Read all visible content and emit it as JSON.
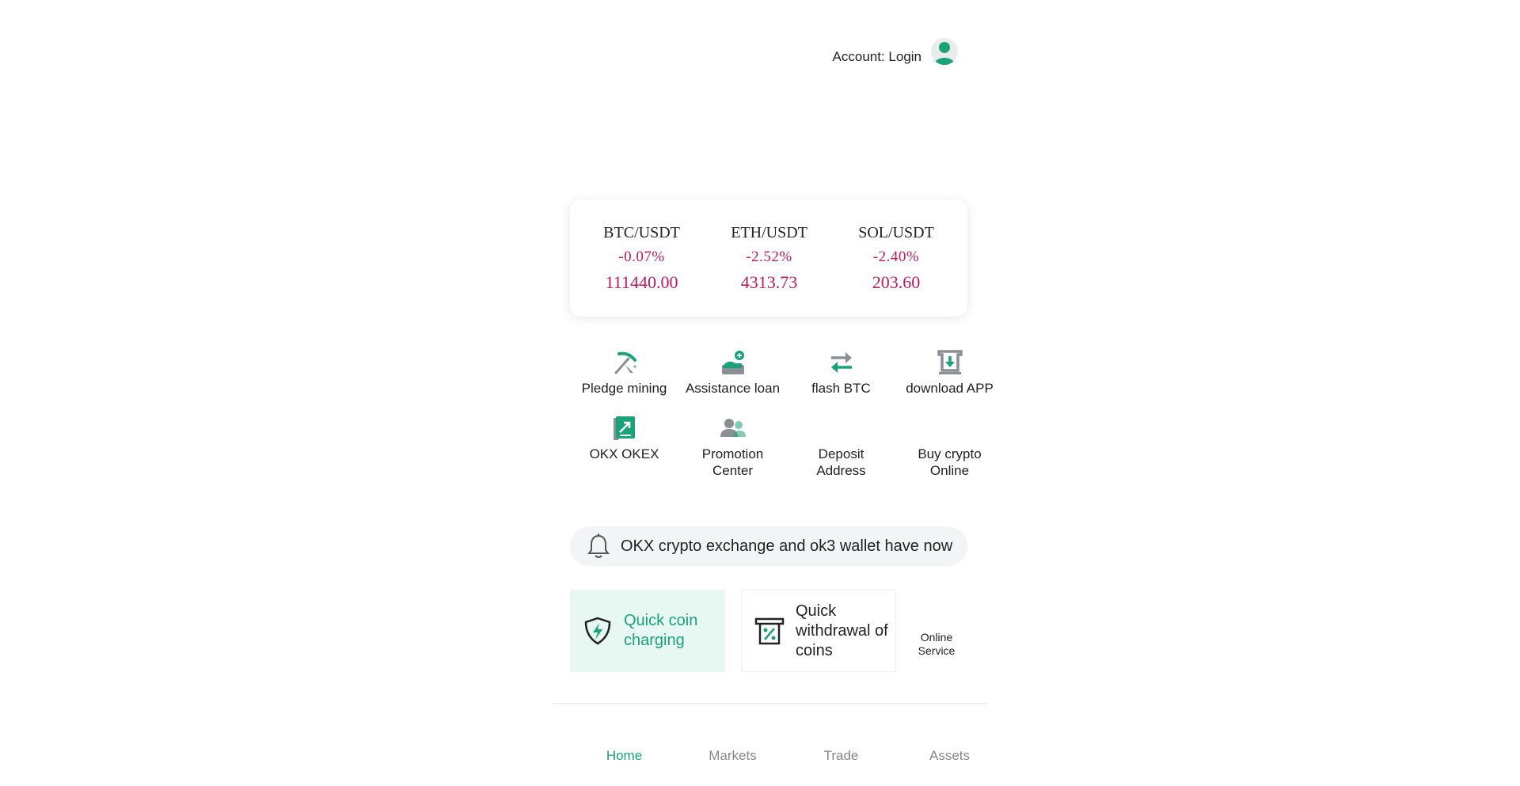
{
  "header": {
    "account_label": "Account: Login",
    "avatar_icon": "user-avatar-icon"
  },
  "colors": {
    "accent_green": "#1aa37a",
    "negative_red": "#c2185b",
    "muted_gray": "#888888"
  },
  "tickers": [
    {
      "pair": "BTC/USDT",
      "change": "-0.07%",
      "price": "111440.00"
    },
    {
      "pair": "ETH/USDT",
      "change": "-2.52%",
      "price": "4313.73"
    },
    {
      "pair": "SOL/USDT",
      "change": "-2.40%",
      "price": "203.60"
    }
  ],
  "quick_grid": [
    {
      "label": "Pledge mining",
      "icon": "pickaxe-icon"
    },
    {
      "label": "Assistance loan",
      "icon": "loan-hand-icon"
    },
    {
      "label": "flash BTC",
      "icon": "swap-arrows-icon"
    },
    {
      "label": "download APP",
      "icon": "download-icon"
    },
    {
      "label": "OKX OKEX",
      "icon": "external-link-icon"
    },
    {
      "label": "Promotion Center",
      "icon": "people-icon"
    },
    {
      "label": "Deposit Address",
      "icon": ""
    },
    {
      "label": "Buy crypto Online",
      "icon": ""
    }
  ],
  "notice": {
    "icon": "bell-icon",
    "text": "OKX crypto exchange and ok3 wallet have now"
  },
  "actions": {
    "charge_label": "Quick coin charging",
    "charge_icon": "shield-bolt-icon",
    "withdraw_label": "Quick withdrawal of coins",
    "withdraw_icon": "withdraw-percent-icon",
    "service_label": "Online Service"
  },
  "nav": {
    "items": [
      "Home",
      "Markets",
      "Trade",
      "Assets"
    ],
    "active": "Home"
  }
}
